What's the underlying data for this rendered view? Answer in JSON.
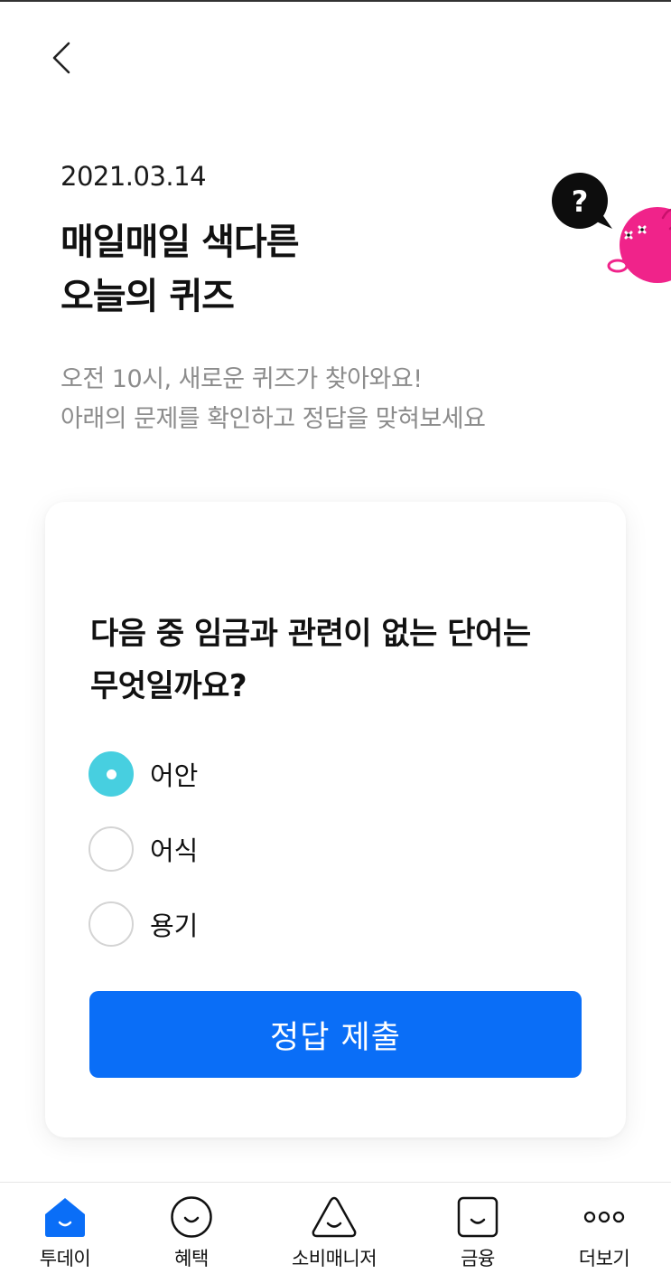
{
  "header": {
    "date": "2021.03.14",
    "title_line1": "매일매일 색다른",
    "title_line2": "오늘의 퀴즈",
    "subtitle_line1": "오전 10시, 새로운 퀴즈가 찾아와요!",
    "subtitle_line2": "아래의 문제를 확인하고 정답을 맞혀보세요",
    "back_icon": "chevron-left-icon",
    "mascot_bubble_text": "?"
  },
  "quiz": {
    "question_line1": "다음 중 임금과 관련이 없는 단어는",
    "question_line2": "무엇일까요?",
    "options": [
      {
        "label": "어안",
        "selected": true
      },
      {
        "label": "어식",
        "selected": false
      },
      {
        "label": "용기",
        "selected": false
      }
    ],
    "submit_label": "정답 제출"
  },
  "tabs": [
    {
      "label": "투데이",
      "icon": "home-icon",
      "active": true
    },
    {
      "label": "혜택",
      "icon": "smile-circle-icon",
      "active": false
    },
    {
      "label": "소비매니저",
      "icon": "triangle-smile-icon",
      "active": false
    },
    {
      "label": "금융",
      "icon": "square-smile-icon",
      "active": false
    },
    {
      "label": "더보기",
      "icon": "more-dots-icon",
      "active": false
    }
  ],
  "colors": {
    "accent_blue": "#0a6ef7",
    "radio_selected": "#47cfe0",
    "mascot_pink": "#f0238a",
    "subtitle_gray": "#8c8c8c"
  }
}
